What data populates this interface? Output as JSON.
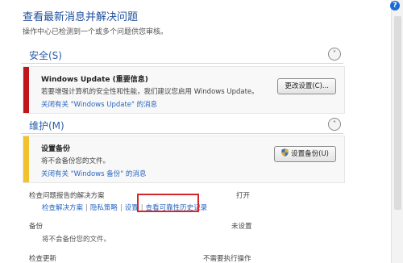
{
  "page": {
    "title": "查看最新消息并解决问题",
    "subtitle": "操作中心已检测到一个或多个问题供您审核。",
    "help_label": "?"
  },
  "security": {
    "label": "安全(S)",
    "chevron": "˅",
    "alert": {
      "heading": "Windows Update (重要信息)",
      "description": "若要增强计算机的安全性和性能，我们建议您启用 Windows Update。",
      "dismiss_link": "关闭有关 \"Windows Update\" 的消息",
      "button_label": "更改设置(C)...",
      "stripe_color": "#c0161b"
    }
  },
  "maintenance": {
    "label": "维护(M)",
    "chevron": "˄",
    "alert": {
      "heading": "设置备份",
      "description": "将不会备份您的文件。",
      "dismiss_link": "关闭有关 \"Windows 备份\" 的消息",
      "button_label": "设置备份(U)",
      "stripe_color": "#f2c12e"
    },
    "problem_reports": {
      "label": "检查问题报告的解决方案",
      "status": "打开",
      "links": [
        "检查解决方案",
        "隐私策略",
        "设置",
        "查看可靠性历史记录"
      ]
    },
    "backup": {
      "label": "备份",
      "status": "未设置",
      "text": "将不会备份您的文件。"
    },
    "check_updates": {
      "label": "检查更新",
      "status": "不需要执行操作"
    }
  }
}
